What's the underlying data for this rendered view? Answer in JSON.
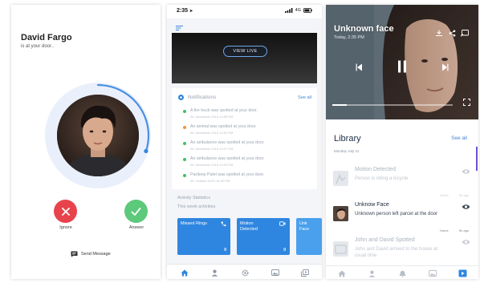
{
  "call": {
    "caller_name": "David Fargo",
    "caller_status": "is at your door..",
    "ignore_label": "Ignore",
    "answer_label": "Answer",
    "send_message_label": "Send Message",
    "timer_progress": 0.3
  },
  "dashboard": {
    "status_time": "2:35",
    "status_network": "4G",
    "view_live_label": "VIEW LIVE",
    "notifications_title": "Notifications",
    "see_all": "See all",
    "notifications": [
      {
        "text": "A fire truck was spotted at your door.",
        "date": "05. November 2019 14:55 PM",
        "color": "#3fc15f"
      },
      {
        "text": "An animal was spotted at your door.",
        "date": "05. November 2019 14:52 PM",
        "color": "#f39235"
      },
      {
        "text": "An ambulance was spotted at your door.",
        "date": "05. November 2019 14:07 PM",
        "color": "#3fc15f"
      },
      {
        "text": "An ambulance was spotted at your door.",
        "date": "05. November 2019 14:03 PM",
        "color": "#3fc15f"
      },
      {
        "text": "Pardeep Patel was spotted at your door.",
        "date": "25. October 2019 14:40 PM",
        "color": "#3fc15f"
      }
    ],
    "activity_title": "Activity Statistics",
    "activity_subtitle": "This week activities",
    "tiles": [
      {
        "label": "Missed Rings",
        "count": "0",
        "color": "#2f86e0"
      },
      {
        "label": "Motion Detected",
        "count": "0",
        "color": "#2f86e0"
      },
      {
        "label": "Unk Face",
        "count": "",
        "color": "#4aa0ec"
      }
    ]
  },
  "library": {
    "video_title": "Unknown face",
    "video_subtitle": "Today, 2:35 PM",
    "video_progress": 0.12,
    "title": "Library",
    "see_all": "See all",
    "date": "Monday July 21",
    "items": [
      {
        "title": "Motion Detected",
        "desc": "Person is riding a bicycle",
        "tag_left": "Home",
        "tag_right": "5h ago"
      },
      {
        "title": "Unknow Face",
        "desc": "Unknown person left parcel at the door",
        "tag_left": "Home",
        "tag_right": "5h ago"
      },
      {
        "title": "John and David Spotted",
        "desc": "John and David arrived to the house at usual time",
        "tag_left": "Home",
        "tag_right": "5h ago"
      }
    ]
  },
  "colors": {
    "accent_blue": "#2f86e0",
    "ignore_red": "#e8434c",
    "answer_green": "#5cc97b"
  }
}
